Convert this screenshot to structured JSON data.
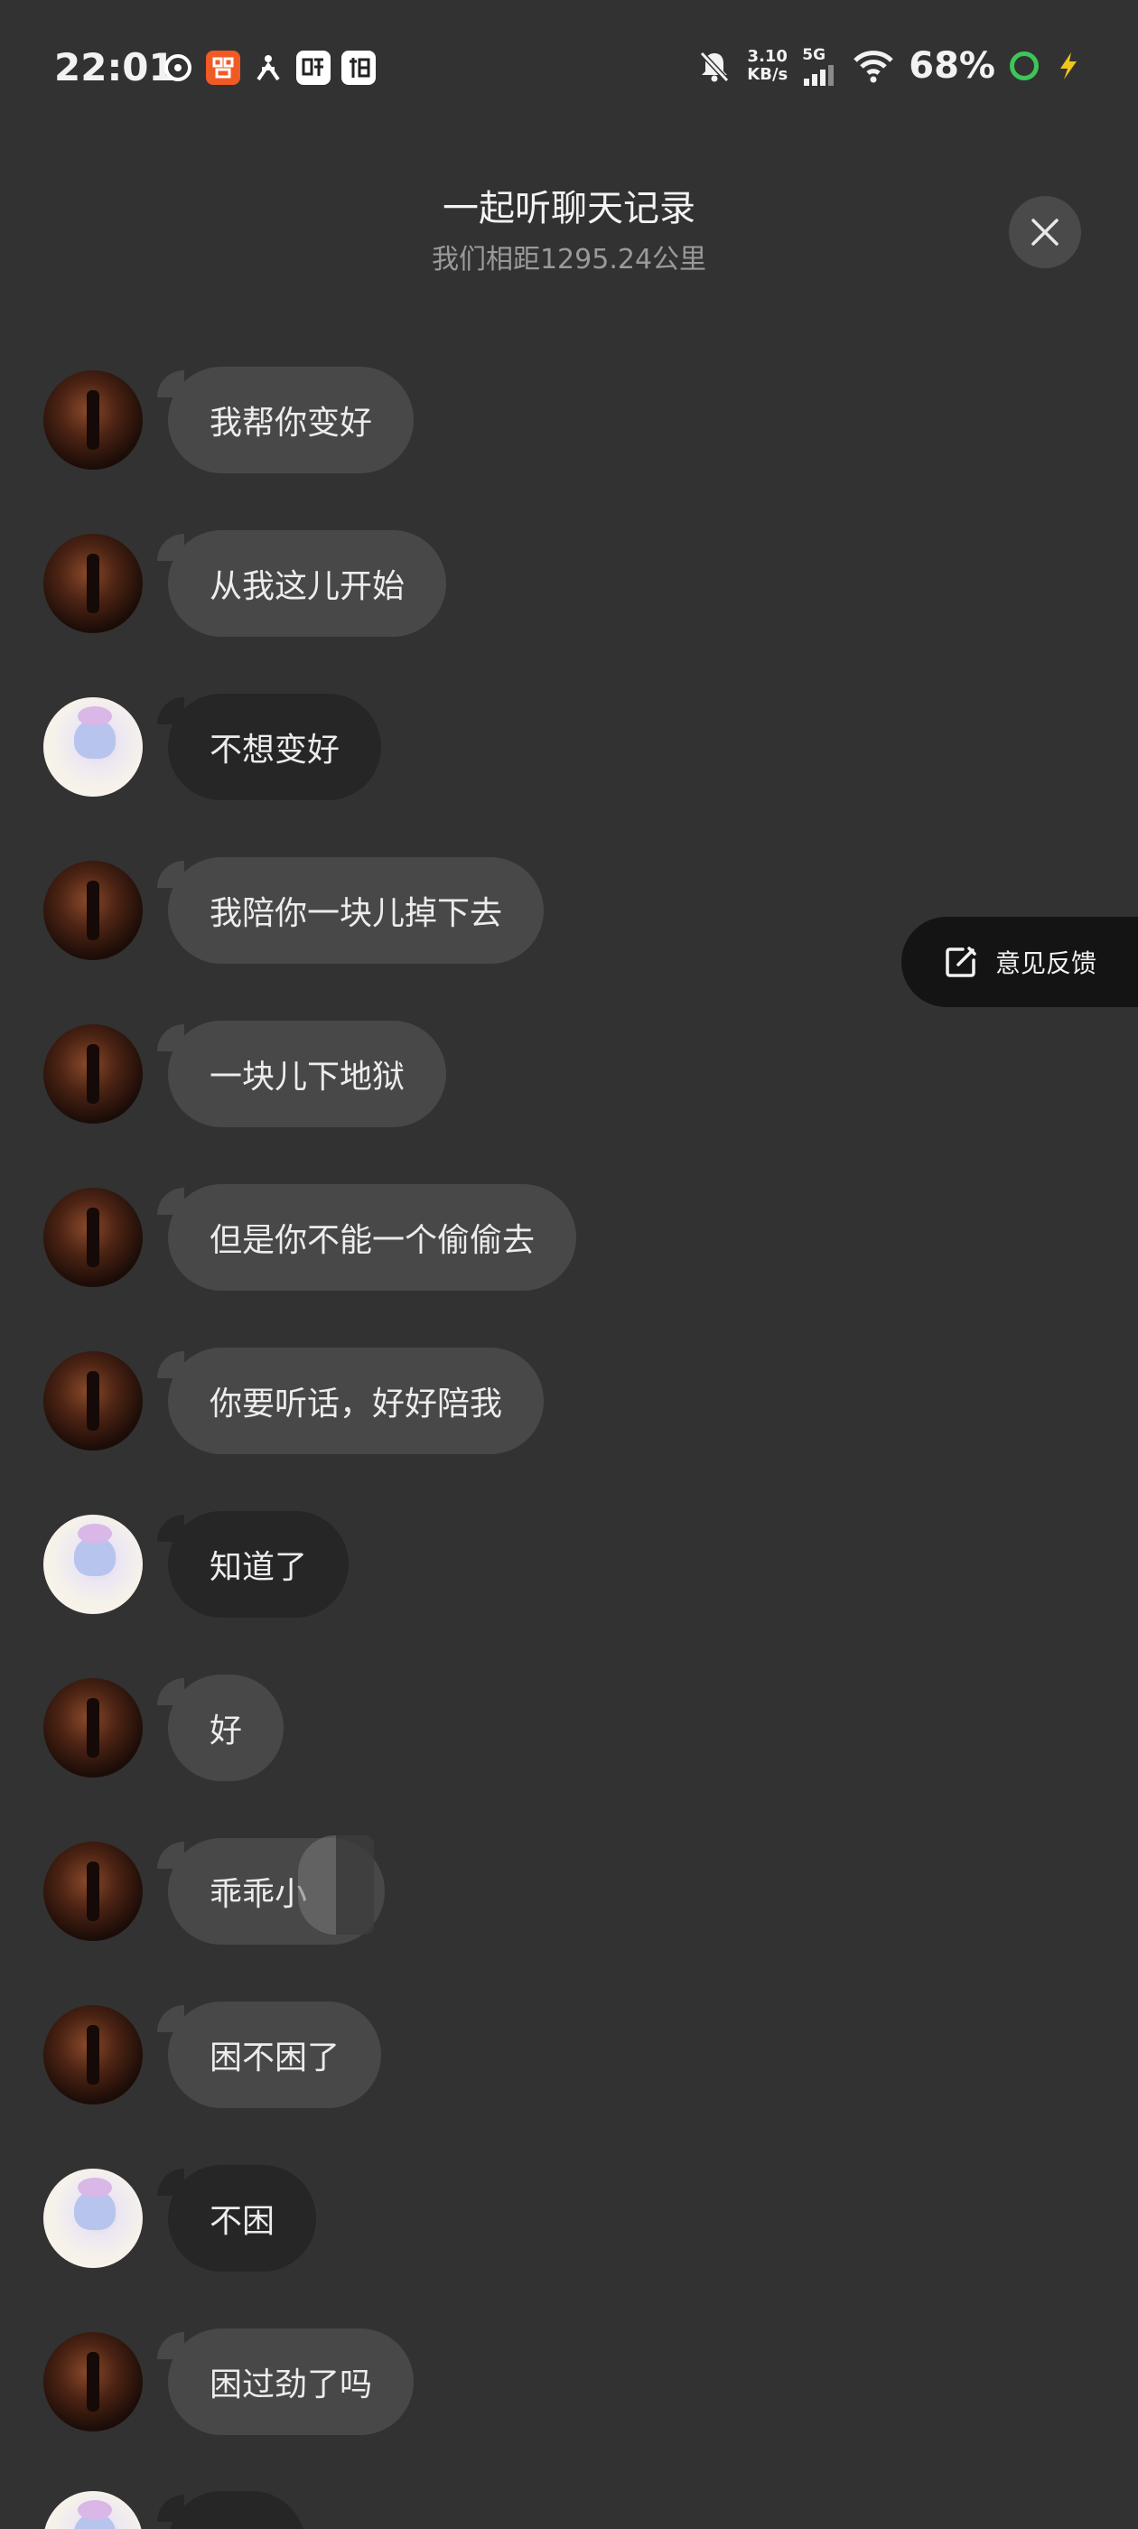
{
  "status_bar": {
    "time": "22:01",
    "speed_value": "3.10",
    "speed_unit": "KB/s",
    "network": "5G",
    "battery": "68%"
  },
  "header": {
    "title": "一起听聊天记录",
    "subtitle": "我们相距1295.24公里"
  },
  "feedback": {
    "label": "意见反馈"
  },
  "messages": [
    {
      "sender": "other",
      "text": "我帮你变好"
    },
    {
      "sender": "other",
      "text": "从我这儿开始"
    },
    {
      "sender": "me",
      "text": "不想变好"
    },
    {
      "sender": "other",
      "text": "我陪你一块儿掉下去"
    },
    {
      "sender": "other",
      "text": "一块儿下地狱"
    },
    {
      "sender": "other",
      "text": "但是你不能一个偷偷去"
    },
    {
      "sender": "other",
      "text": "你要听话，好好陪我"
    },
    {
      "sender": "me",
      "text": "知道了"
    },
    {
      "sender": "other",
      "text": "好"
    },
    {
      "sender": "other",
      "text": "乖乖小"
    },
    {
      "sender": "other",
      "text": "困不困了"
    },
    {
      "sender": "me",
      "text": "不困"
    },
    {
      "sender": "other",
      "text": "困过劲了吗"
    }
  ]
}
